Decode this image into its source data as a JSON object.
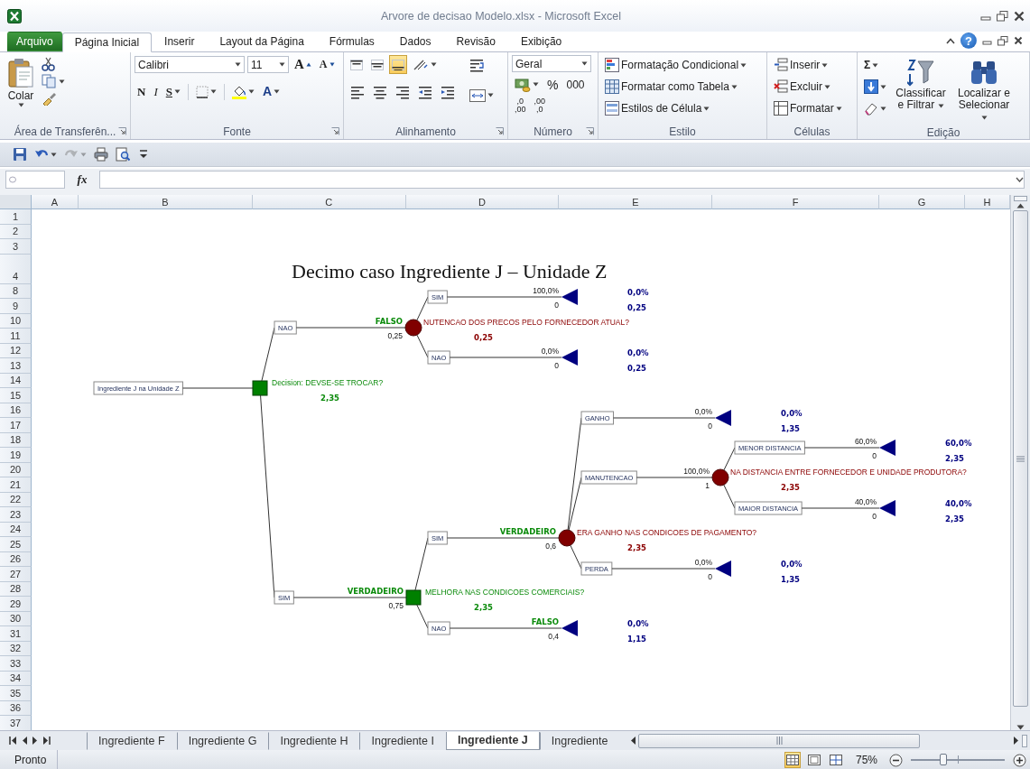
{
  "window": {
    "title": "Arvore de decisao Modelo.xlsx - Microsoft Excel",
    "help": "?"
  },
  "ribbon_tabs": [
    {
      "label": "Arquivo",
      "kind": "file",
      "selected": false
    },
    {
      "label": "Página Inicial",
      "kind": "tab",
      "selected": true
    },
    {
      "label": "Inserir",
      "kind": "tab",
      "selected": false
    },
    {
      "label": "Layout da Página",
      "kind": "tab",
      "selected": false
    },
    {
      "label": "Fórmulas",
      "kind": "tab",
      "selected": false
    },
    {
      "label": "Dados",
      "kind": "tab",
      "selected": false
    },
    {
      "label": "Revisão",
      "kind": "tab",
      "selected": false
    },
    {
      "label": "Exibição",
      "kind": "tab",
      "selected": false
    }
  ],
  "ribbon_groups": [
    {
      "label": "Área de Transferên...",
      "launcher": true,
      "kind": "clipboard",
      "paste": "Colar"
    },
    {
      "label": "Fonte",
      "launcher": true,
      "kind": "font",
      "font": "Calibri",
      "size": "11",
      "grow": "A",
      "shrink": "A",
      "bold": "N",
      "italic": "I",
      "underline": "S",
      "font_color": "A"
    },
    {
      "label": "Alinhamento",
      "launcher": true,
      "kind": "alignment",
      "vertical_align": [
        {
          "selected": false
        },
        {
          "selected": false
        },
        {
          "selected": true
        }
      ]
    },
    {
      "label": "Número",
      "launcher": true,
      "kind": "number",
      "format": "Geral",
      "percent": "%",
      "thousands": "000",
      "add_decimal": [
        ",0",
        ",00"
      ],
      "remove_decimal": [
        ",00",
        ",0"
      ]
    },
    {
      "label": "Estilo",
      "launcher": false,
      "kind": "styles",
      "items": [
        "Formatação Condicional",
        "Formatar como Tabela",
        "Estilos de Célula"
      ]
    },
    {
      "label": "Células",
      "launcher": false,
      "kind": "cells",
      "items": [
        "Inserir",
        "Excluir",
        "Formatar"
      ]
    },
    {
      "label": "Edição",
      "launcher": false,
      "kind": "editing",
      "sum": "Σ",
      "sort": "Classificar e Filtrar",
      "find": "Localizar e Selecionar"
    }
  ],
  "quick_access": [
    {
      "kind": "save",
      "disabled": false
    },
    {
      "kind": "undo",
      "disabled": false
    },
    {
      "kind": "redo",
      "disabled": true
    },
    {
      "kind": "print",
      "disabled": false
    },
    {
      "kind": "preview",
      "disabled": false
    },
    {
      "kind": "customize",
      "disabled": false
    }
  ],
  "formula_bar": {
    "function_label": "fx"
  },
  "sheet": {
    "columns": [
      "A",
      "B",
      "C",
      "D",
      "E",
      "F",
      "G",
      "H"
    ],
    "rows": [
      {
        "header": "1",
        "kind": "normal"
      },
      {
        "header": "2",
        "kind": "normal"
      },
      {
        "header": "3",
        "kind": "normal"
      },
      {
        "header": "4",
        "kind": "tall"
      },
      {
        "header": "8",
        "kind": "normal"
      },
      {
        "header": "9",
        "kind": "normal"
      },
      {
        "header": "10",
        "kind": "normal"
      },
      {
        "header": "11",
        "kind": "normal"
      },
      {
        "header": "12",
        "kind": "normal"
      },
      {
        "header": "13",
        "kind": "normal"
      },
      {
        "header": "14",
        "kind": "normal"
      },
      {
        "header": "15",
        "kind": "normal"
      },
      {
        "header": "16",
        "kind": "normal"
      },
      {
        "header": "17",
        "kind": "normal"
      },
      {
        "header": "18",
        "kind": "normal"
      },
      {
        "header": "19",
        "kind": "normal"
      },
      {
        "header": "20",
        "kind": "normal"
      },
      {
        "header": "21",
        "kind": "normal"
      },
      {
        "header": "22",
        "kind": "normal"
      },
      {
        "header": "23",
        "kind": "normal"
      },
      {
        "header": "24",
        "kind": "normal"
      },
      {
        "header": "25",
        "kind": "normal"
      },
      {
        "header": "26",
        "kind": "normal"
      },
      {
        "header": "27",
        "kind": "normal"
      },
      {
        "header": "28",
        "kind": "normal"
      },
      {
        "header": "29",
        "kind": "normal"
      },
      {
        "header": "30",
        "kind": "normal"
      },
      {
        "header": "31",
        "kind": "normal"
      },
      {
        "header": "32",
        "kind": "normal"
      },
      {
        "header": "33",
        "kind": "normal"
      },
      {
        "header": "34",
        "kind": "normal"
      },
      {
        "header": "35",
        "kind": "normal"
      },
      {
        "header": "36",
        "kind": "normal"
      },
      {
        "header": "37",
        "kind": "normal"
      }
    ],
    "title": "Decimo caso Ingrediente J – Unidade Z",
    "decision_tree": {
      "label": "Ingrediente J na Unidade Z",
      "node": {
        "kind": "decision",
        "title": "Decision: DEVSE-SE TROCAR?",
        "value": "2,35",
        "children": [
          {
            "label": "NAO",
            "upper": "FALSO",
            "lower": "0,25",
            "node": {
              "kind": "chance",
              "title": "NUTENCAO DOS PRECOS PELO FORNECEDOR ATUAL?",
              "value": "0,25",
              "children": [
                {
                  "label": "SIM",
                  "upper": "100,0%",
                  "lower": "0",
                  "node": {
                    "kind": "end",
                    "probability": "0,0%",
                    "value": "0,25"
                  }
                },
                {
                  "label": "NAO",
                  "upper": "0,0%",
                  "lower": "0",
                  "node": {
                    "kind": "end",
                    "probability": "0,0%",
                    "value": "0,25"
                  }
                }
              ]
            }
          },
          {
            "label": "SIM",
            "upper": "VERDADEIRO",
            "lower": "0,75",
            "node": {
              "kind": "decision",
              "title": "MELHORA NAS CONDICOES COMERCIAIS?",
              "value": "2,35",
              "children": [
                {
                  "label": "SIM",
                  "upper": "VERDADEIRO",
                  "lower": "0,6",
                  "node": {
                    "kind": "chance",
                    "title": "ERA GANHO NAS CONDICOES DE PAGAMENTO?",
                    "value": "2,35",
                    "children": [
                      {
                        "label": "GANHO",
                        "upper": "0,0%",
                        "lower": "0",
                        "node": {
                          "kind": "end",
                          "probability": "0,0%",
                          "value": "1,35"
                        }
                      },
                      {
                        "label": "MANUTENCAO",
                        "upper": "100,0%",
                        "lower": "1",
                        "node": {
                          "kind": "chance",
                          "title": "NA DISTANCIA ENTRE FORNECEDOR E UNIDADE PRODUTORA?",
                          "value": "2,35",
                          "children": [
                            {
                              "label": "MENOR DISTANCIA",
                              "upper": "60,0%",
                              "lower": "0",
                              "node": {
                                "kind": "end",
                                "probability": "60,0%",
                                "value": "2,35"
                              }
                            },
                            {
                              "label": "MAIOR DISTANCIA",
                              "upper": "40,0%",
                              "lower": "0",
                              "node": {
                                "kind": "end",
                                "probability": "40,0%",
                                "value": "2,35"
                              }
                            }
                          ]
                        }
                      },
                      {
                        "label": "PERDA",
                        "upper": "0,0%",
                        "lower": "0",
                        "node": {
                          "kind": "end",
                          "probability": "0,0%",
                          "value": "1,35"
                        }
                      }
                    ]
                  }
                },
                {
                  "label": "NAO",
                  "upper": "FALSO",
                  "lower": "0,4",
                  "node": {
                    "kind": "end",
                    "probability": "0,0%",
                    "value": "1,15"
                  }
                }
              ]
            }
          }
        ]
      }
    }
  },
  "sheet_tabs": [
    {
      "label": "Ingrediente F",
      "selected": false
    },
    {
      "label": "Ingrediente G",
      "selected": false
    },
    {
      "label": "Ingrediente H",
      "selected": false
    },
    {
      "label": "Ingrediente I",
      "selected": false
    },
    {
      "label": "Ingrediente J",
      "selected": true
    },
    {
      "label": "Ingrediente",
      "selected": false
    }
  ],
  "status_bar": {
    "status": "Pronto",
    "views": [
      {
        "kind": "normal",
        "selected": true
      },
      {
        "kind": "layout",
        "selected": false
      },
      {
        "kind": "break",
        "selected": false
      }
    ],
    "zoom": "75%",
    "zoom_slider": {
      "level": 0.35
    }
  }
}
